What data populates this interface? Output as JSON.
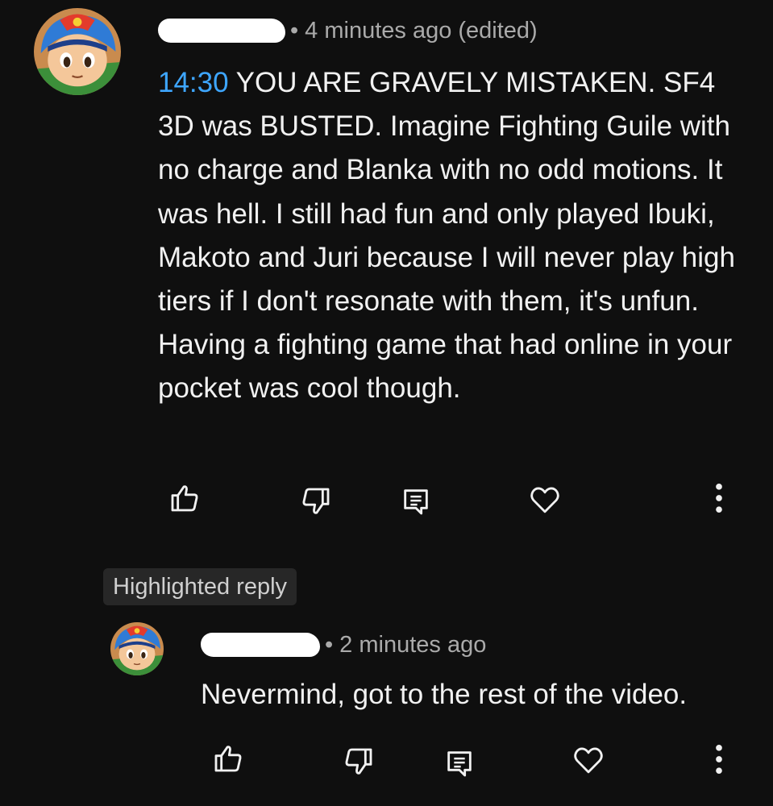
{
  "comment": {
    "meta_separator": "•",
    "time_ago": "4 minutes ago (edited)",
    "timestamp_link": "14:30",
    "body": " YOU ARE GRAVELY MISTAKEN. SF4 3D was BUSTED. Imagine Fighting Guile with no charge and Blanka with no odd motions. It was hell. I still had fun and only played Ibuki, Makoto and Juri because I will never play high tiers if I don't resonate with them, it's unfun. Having a fighting game that had online in your pocket was cool though.",
    "actions": [
      "thumbs-up-icon",
      "thumbs-down-icon",
      "reply-icon",
      "heart-icon",
      "more-options-icon"
    ]
  },
  "reply": {
    "badge_label": "Highlighted reply",
    "meta_separator": "•",
    "time_ago": "2 minutes ago",
    "body": "Nevermind, got to the rest of the video.",
    "actions": [
      "thumbs-up-icon",
      "thumbs-down-icon",
      "reply-icon",
      "heart-icon",
      "more-options-icon"
    ]
  },
  "colors": {
    "background": "#0f0f0f",
    "text_primary": "#f1f1f1",
    "text_secondary": "#aaaaaa",
    "link": "#3ea6ff",
    "badge_background": "#272727"
  }
}
